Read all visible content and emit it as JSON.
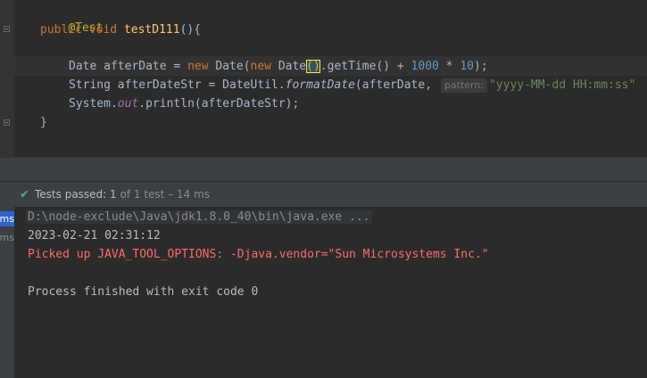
{
  "editor": {
    "annotation": "@Test",
    "sig_public": "public",
    "sig_void": "void",
    "sig_name": "testD111",
    "sig_tail": "(){",
    "l3_type": "Date ",
    "l3_var": "afterDate = ",
    "l3_new1": "new",
    "l3_ctor1": " Date(",
    "l3_new2": "new",
    "l3_ctor2": " Date",
    "l3_cursor_paren": "()",
    "l3_call": ".getTime() + ",
    "l3_num1": "1000",
    "l3_mul": " * ",
    "l3_num2": "10",
    "l3_end": ");",
    "l4_a": "String afterDateStr = DateUtil.",
    "l4_method": "formatDate",
    "l4_b": "(afterDate, ",
    "l4_hint": "pattern:",
    "l4_str": "\"yyyy-MM-dd HH:mm:ss\"",
    "l5_a": "System.",
    "l5_field": "out",
    "l5_b": ".println(afterDateStr);",
    "close_brace": "}"
  },
  "run": {
    "status_label": "Tests passed:",
    "status_count": "1",
    "status_detail": "of 1 test – 14 ms"
  },
  "sidebar": {
    "tab1": "ms",
    "tab2": "ms"
  },
  "console": {
    "cmd": "D:\\node-exclude\\Java\\jdk1.8.0_40\\bin\\java.exe ...",
    "date_line": "2023-02-21 02:31:12",
    "picked_up": "Picked up JAVA_TOOL_OPTIONS: -Djava.vendor=\"Sun Microsystems Inc.\"",
    "finished": "Process finished with exit code 0"
  },
  "colors": {
    "keyword": "#cc7832",
    "annotation": "#bbb529",
    "method_decl": "#ffc66d",
    "number": "#6897bb",
    "string": "#6a8759",
    "field": "#9876aa",
    "error_text": "#ff6b68",
    "pass_check": "#59a869"
  },
  "icons": {
    "pass": "check-icon",
    "fold": "fold-marker-icon"
  }
}
